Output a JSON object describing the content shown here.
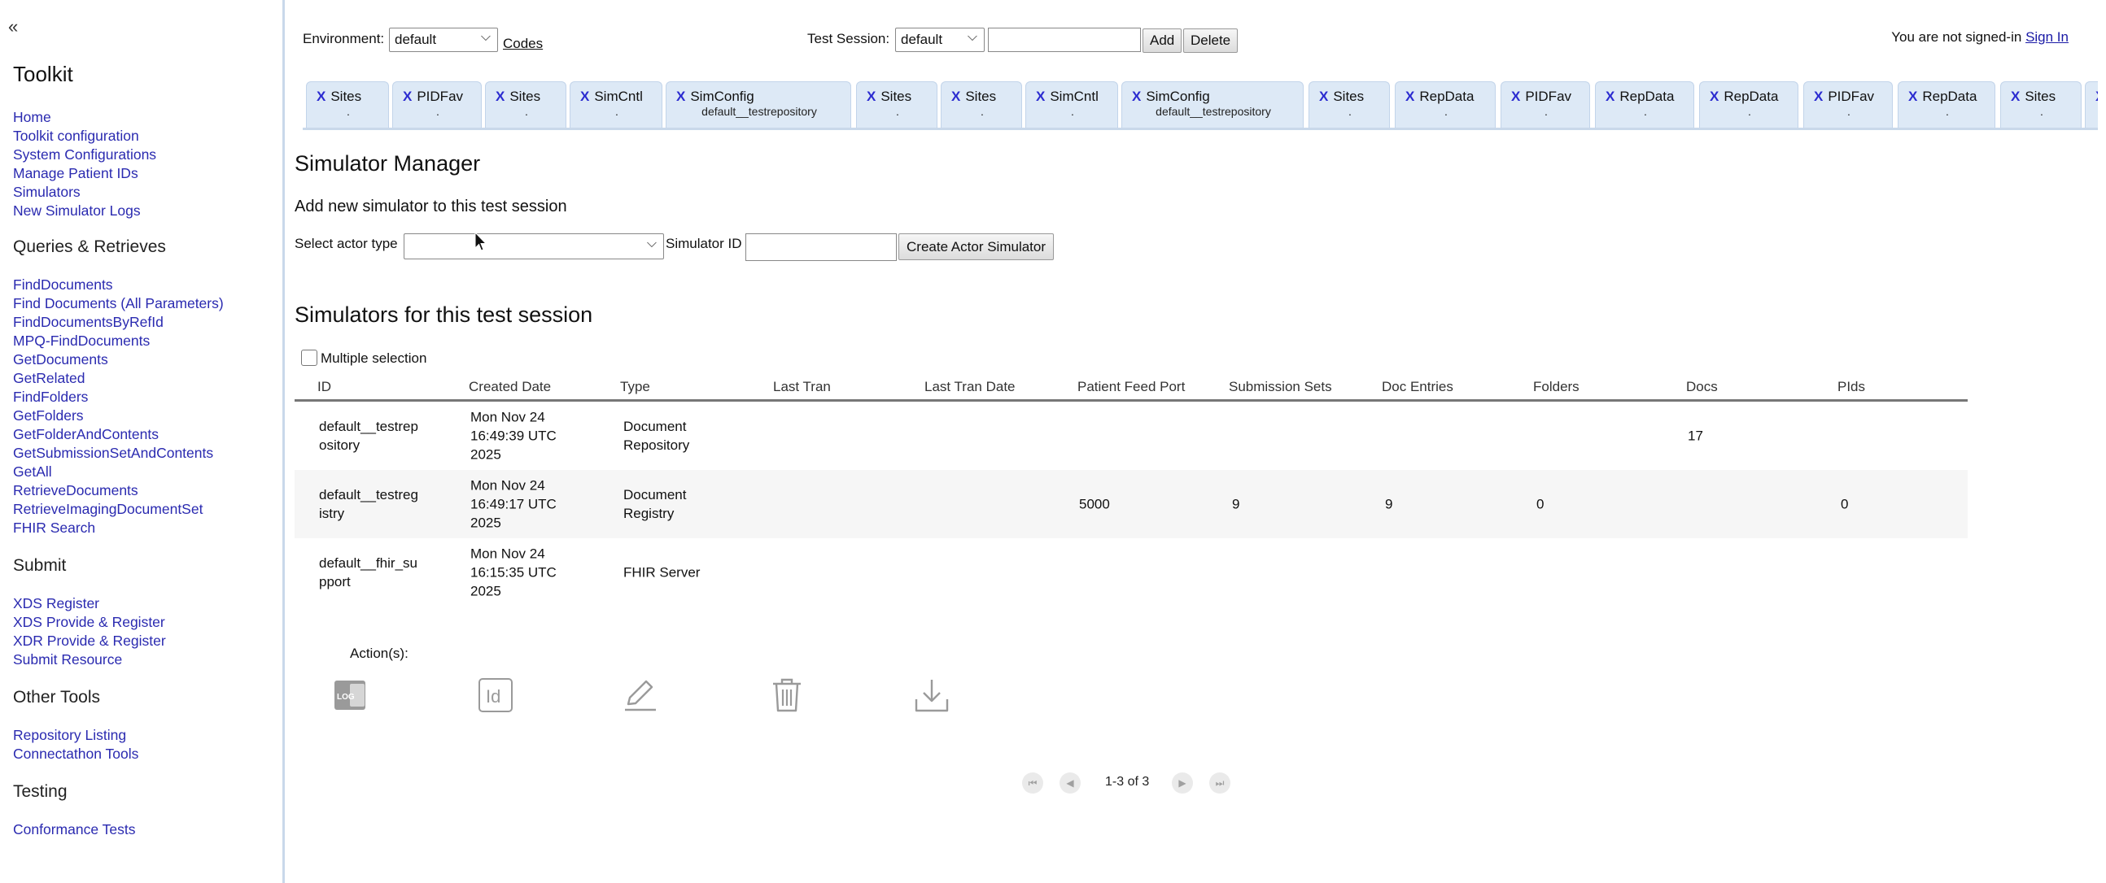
{
  "sidebar": {
    "collapse": "«",
    "title": "Toolkit",
    "sections": {
      "main": [
        "Home",
        "Toolkit configuration",
        "System Configurations",
        "Manage Patient IDs",
        "Simulators",
        "New Simulator Logs"
      ],
      "queries_title": "Queries & Retrieves",
      "queries": [
        "FindDocuments",
        "Find Documents (All Parameters)",
        "FindDocumentsByRefId",
        "MPQ-FindDocuments",
        "GetDocuments",
        "GetRelated",
        "FindFolders",
        "GetFolders",
        "GetFolderAndContents",
        "GetSubmissionSetAndContents",
        "GetAll",
        "RetrieveDocuments",
        "RetrieveImagingDocumentSet",
        "FHIR Search"
      ],
      "submit_title": "Submit",
      "submit": [
        "XDS Register",
        "XDS Provide & Register",
        "XDR Provide & Register",
        "Submit Resource"
      ],
      "other_title": "Other Tools",
      "other": [
        "Repository Listing",
        "Connectathon Tools"
      ],
      "testing_title": "Testing",
      "testing": [
        "Conformance Tests"
      ]
    }
  },
  "topbar": {
    "environment_label": "Environment:",
    "environment_value": "default",
    "codes_link": "Codes",
    "test_session_label": "Test Session:",
    "test_session_value": "default",
    "add_label": "Add",
    "delete_label": "Delete",
    "signin_text": "You are not signed-in",
    "signin_link": "Sign In"
  },
  "tabs": [
    {
      "label": "Sites",
      "sub": "."
    },
    {
      "label": "PIDFav",
      "sub": "."
    },
    {
      "label": "Sites",
      "sub": "."
    },
    {
      "label": "SimCntl",
      "sub": "."
    },
    {
      "label": "SimConfig",
      "sub": "default__testrepository"
    },
    {
      "label": "Sites",
      "sub": "."
    },
    {
      "label": "Sites",
      "sub": "."
    },
    {
      "label": "SimCntl",
      "sub": "."
    },
    {
      "label": "SimConfig",
      "sub": "default__testrepository"
    },
    {
      "label": "Sites",
      "sub": "."
    },
    {
      "label": "RepData",
      "sub": "."
    },
    {
      "label": "PIDFav",
      "sub": "."
    },
    {
      "label": "RepData",
      "sub": "."
    },
    {
      "label": "RepData",
      "sub": "."
    },
    {
      "label": "PIDFav",
      "sub": "."
    },
    {
      "label": "RepData",
      "sub": "."
    },
    {
      "label": "Sites",
      "sub": "."
    },
    {
      "label": "",
      "sub": ""
    }
  ],
  "main": {
    "title": "Simulator Manager",
    "add_heading": "Add new simulator to this test session",
    "actor_type_label": "Select actor type",
    "actor_type_value": "",
    "sim_id_label": "Simulator ID",
    "sim_id_value": "",
    "create_button": "Create Actor Simulator",
    "sims_heading": "Simulators for this test session",
    "multi_selection": "Multiple selection"
  },
  "table": {
    "columns": [
      "ID",
      "Created Date",
      "Type",
      "Last Tran",
      "Last Tran Date",
      "Patient Feed Port",
      "Submission Sets",
      "Doc Entries",
      "Folders",
      "Docs",
      "PIds"
    ],
    "rows": [
      {
        "id": [
          "default__testrep",
          "ository"
        ],
        "created": [
          "Mon Nov 24",
          "16:49:39 UTC",
          "2025"
        ],
        "type": [
          "Document",
          "Repository"
        ],
        "last_tran": "",
        "last_tran_date": "",
        "patient_feed_port": "",
        "submission_sets": "",
        "doc_entries": "",
        "folders": "",
        "docs": "17",
        "pids": ""
      },
      {
        "id": [
          "default__testreg",
          "istry"
        ],
        "created": [
          "Mon Nov 24",
          "16:49:17 UTC",
          "2025"
        ],
        "type": [
          "Document",
          "Registry"
        ],
        "last_tran": "",
        "last_tran_date": "",
        "patient_feed_port": "5000",
        "submission_sets": "9",
        "doc_entries": "9",
        "folders": "0",
        "docs": "",
        "pids": "0"
      },
      {
        "id": [
          "default__fhir_su",
          "pport"
        ],
        "created": [
          "Mon Nov 24",
          "16:15:35 UTC",
          "2025"
        ],
        "type": [
          "FHIR Server",
          ""
        ],
        "last_tran": "",
        "last_tran_date": "",
        "patient_feed_port": "",
        "submission_sets": "",
        "doc_entries": "",
        "folders": "",
        "docs": "",
        "pids": ""
      }
    ]
  },
  "actions": {
    "label": "Action(s):",
    "icons": [
      "log-icon",
      "id-icon",
      "edit-icon",
      "trash-icon",
      "download-icon"
    ],
    "log_text": "LOG",
    "id_text": "Id"
  },
  "pager": {
    "text": "1-3 of 3"
  }
}
